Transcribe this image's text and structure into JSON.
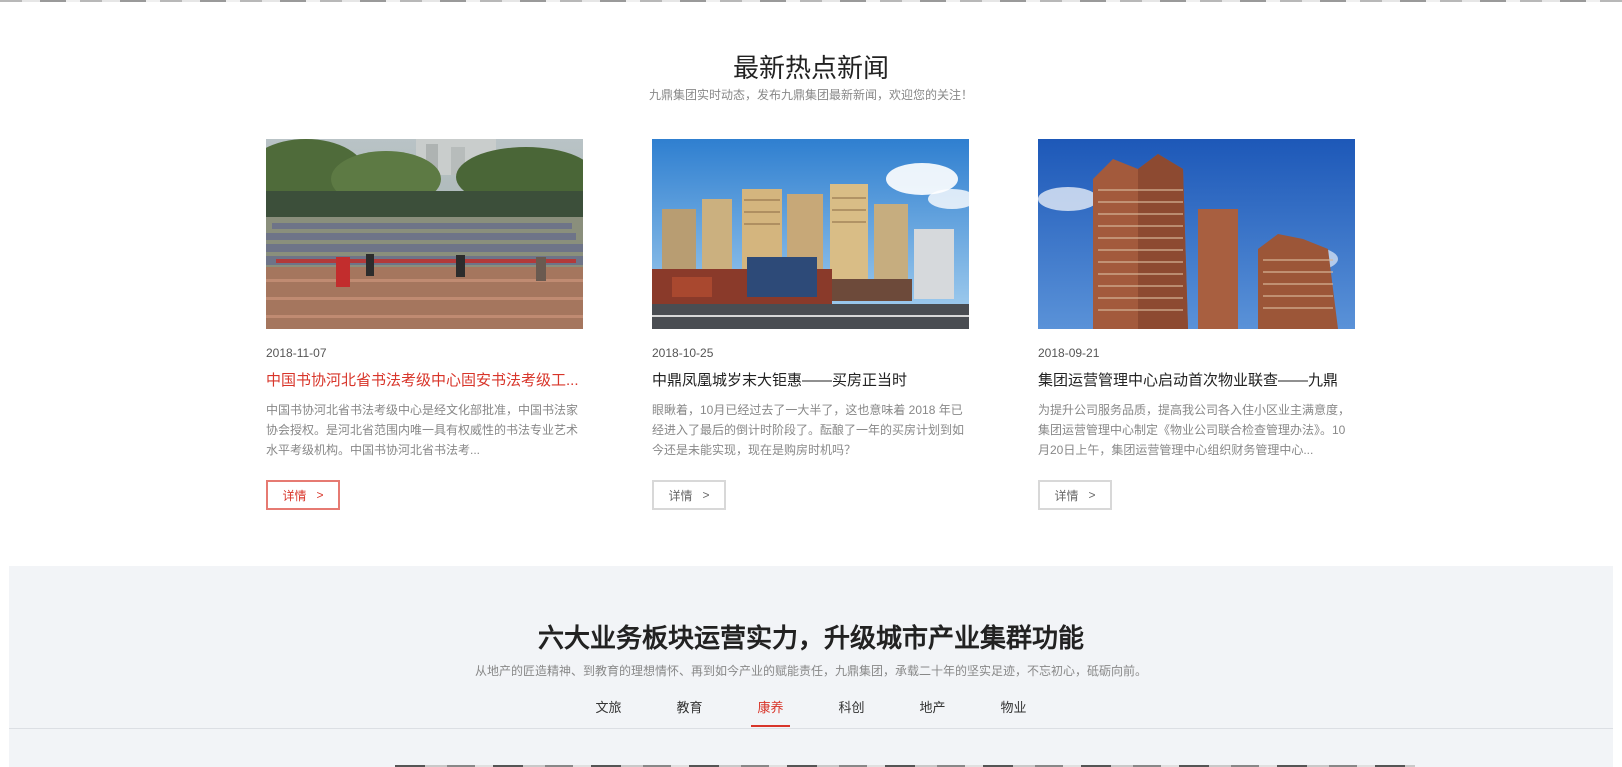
{
  "news": {
    "title": "最新热点新闻",
    "subtitle": "九鼎集团实时动态，发布九鼎集团最新新闻，欢迎您的关注！",
    "items": [
      {
        "date": "2018-11-07",
        "title": "中国书协河北省书法考级中心固安书法考级工...",
        "desc": "中国书协河北省书法考级中心是经文化部批准，中国书法家协会授权。是河北省范围内唯一具有权威性的书法专业艺术水平考级机构。中国书协河北省书法考...",
        "button": "详情",
        "arrow": ">",
        "image_icon": "school-ceremony-photo"
      },
      {
        "date": "2018-10-25",
        "title": "中鼎凤凰城岁末大钜惠——买房正当时",
        "desc": "眼瞅着，10月已经过去了一大半了，这也意味着 2018 年已经进入了最后的倒计时阶段了。酝酿了一年的买房计划到如今还是未能实现，现在是购房时机吗？",
        "button": "详情",
        "arrow": ">",
        "image_icon": "residential-complex-photo"
      },
      {
        "date": "2018-09-21",
        "title": "集团运营管理中心启动首次物业联查——九鼎",
        "desc": "为提升公司服务品质，提高我公司各入住小区业主满意度，集团运营管理中心制定《物业公司联合检查管理办法》。10月20日上午，集团运营管理中心组织财务管理中心...",
        "button": "详情",
        "arrow": ">",
        "image_icon": "apartment-towers-photo"
      }
    ]
  },
  "business": {
    "title": "六大业务板块运营实力，升级城市产业集群功能",
    "subtitle": "从地产的匠造精神、到教育的理想情怀、再到如今产业的赋能责任，九鼎集团，承载二十年的坚实足迹，不忘初心，砥砺向前。",
    "tabs": [
      "文旅",
      "教育",
      "康养",
      "科创",
      "地产",
      "物业"
    ],
    "active_tab": "康养"
  },
  "colors": {
    "accent": "#d8352a",
    "section_bg": "#f2f4f7"
  }
}
